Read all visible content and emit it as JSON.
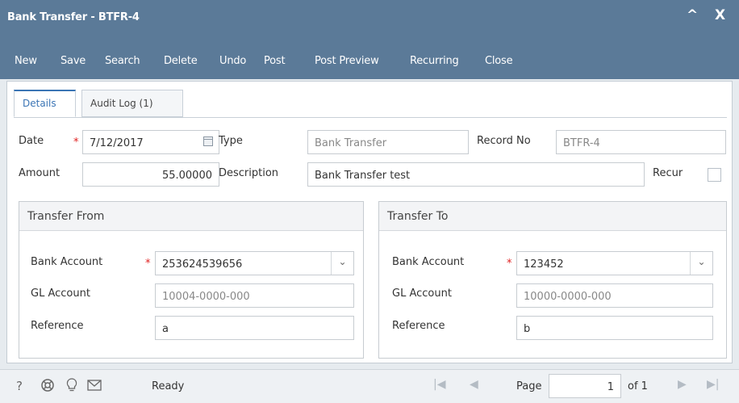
{
  "window": {
    "title": "Bank Transfer - BTFR-4",
    "collapse_glyph": "^",
    "close_glyph": "X"
  },
  "toolbar": {
    "new": "New",
    "save": "Save",
    "search": "Search",
    "delete": "Delete",
    "undo": "Undo",
    "post": "Post",
    "post_preview": "Post Preview",
    "recurring": "Recurring",
    "close": "Close"
  },
  "tabs": {
    "details": "Details",
    "audit_log": "Audit Log (1)"
  },
  "form": {
    "date_label": "Date",
    "date_value": "7/12/2017",
    "type_label": "Type",
    "type_value": "Bank Transfer",
    "record_no_label": "Record No",
    "record_no_value": "BTFR-4",
    "amount_label": "Amount",
    "amount_value": "55.00000",
    "description_label": "Description",
    "description_value": "Bank Transfer test",
    "recur_label": "Recur",
    "recur_checked": false,
    "required_marker": "*"
  },
  "transfer_from": {
    "title": "Transfer From",
    "bank_account_label": "Bank Account",
    "bank_account_value": "253624539656",
    "gl_account_label": "GL Account",
    "gl_account_value": "10004-0000-000",
    "reference_label": "Reference",
    "reference_value": "a"
  },
  "transfer_to": {
    "title": "Transfer To",
    "bank_account_label": "Bank Account",
    "bank_account_value": "123452",
    "gl_account_label": "GL Account",
    "gl_account_value": "10000-0000-000",
    "reference_label": "Reference",
    "reference_value": "b"
  },
  "statusbar": {
    "help_glyph": "?",
    "status": "Ready",
    "page_label": "Page",
    "page_value": "1",
    "page_of": "of 1"
  },
  "colors": {
    "header_bg": "#5b7a98",
    "accent": "#3b75b5",
    "required": "#e02020"
  }
}
